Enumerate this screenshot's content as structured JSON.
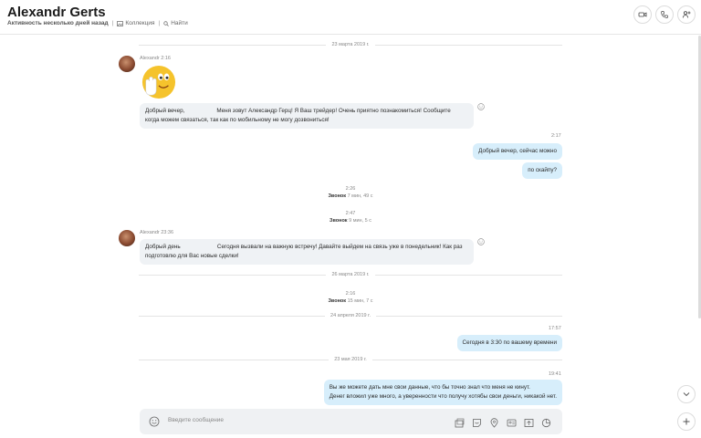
{
  "header": {
    "title": "Alexandr Gerts",
    "activity": "Активность несколько дней назад",
    "collection": "Коллекция",
    "find": "Найти",
    "sep": "|"
  },
  "dividers": [
    "23 марта 2019 г.",
    "26 марта 2019 г.",
    "24 апреля 2019 г.",
    "23 мая 2019 г."
  ],
  "messages": {
    "m1_meta": "Alexandr 2:16",
    "m2_text_l1": "Добрый вечер,                    Меня зовут Александр Герц! Я Ваш трейдер! Очень приятно познакомиться! Сообщите",
    "m2_text_l2": "когда можем связаться, так как по мобильному не могу дозвониться!",
    "out1_time": "2:17",
    "out1_text": "Добрый вечер, сейчас можно",
    "out2_text": "по скайпу?",
    "call1_time": "2:26",
    "call1_label": "Звонок",
    "call1_dur": "7 мин, 49 с",
    "call2_time": "2:47",
    "call2_label": "Звонок",
    "call2_dur": "9 мин, 5 с",
    "m3_meta": "Alexandr 23:36",
    "m3_text_l1": "Добрый день                       Сегодня вызвали на важную встречу! Давайте выйдем на связь уже в понедельник! Как раз",
    "m3_text_l2": "подготовлю для Вас новые сделки!",
    "call3_time": "2:16",
    "call3_label": "Звонок",
    "call3_dur": "15 мин, 7 с",
    "out3_time": "17:57",
    "out3_text": "Сегодня в 3:30 по вашему времени",
    "out4_time": "19:41",
    "out4_text_l1": "Вы же можете дать мне свои данные, что бы точно знал что меня не кинут.",
    "out4_text_l2": "Денег вложил уже много, а уверенности что получу хотябы свои деньги, никакой нет."
  },
  "composer": {
    "placeholder": "Введите сообщение"
  },
  "colors": {
    "incoming_bubble": "#eff2f5",
    "outgoing_bubble": "#d7eefb",
    "emoji_yellow": "#f5c32c"
  }
}
